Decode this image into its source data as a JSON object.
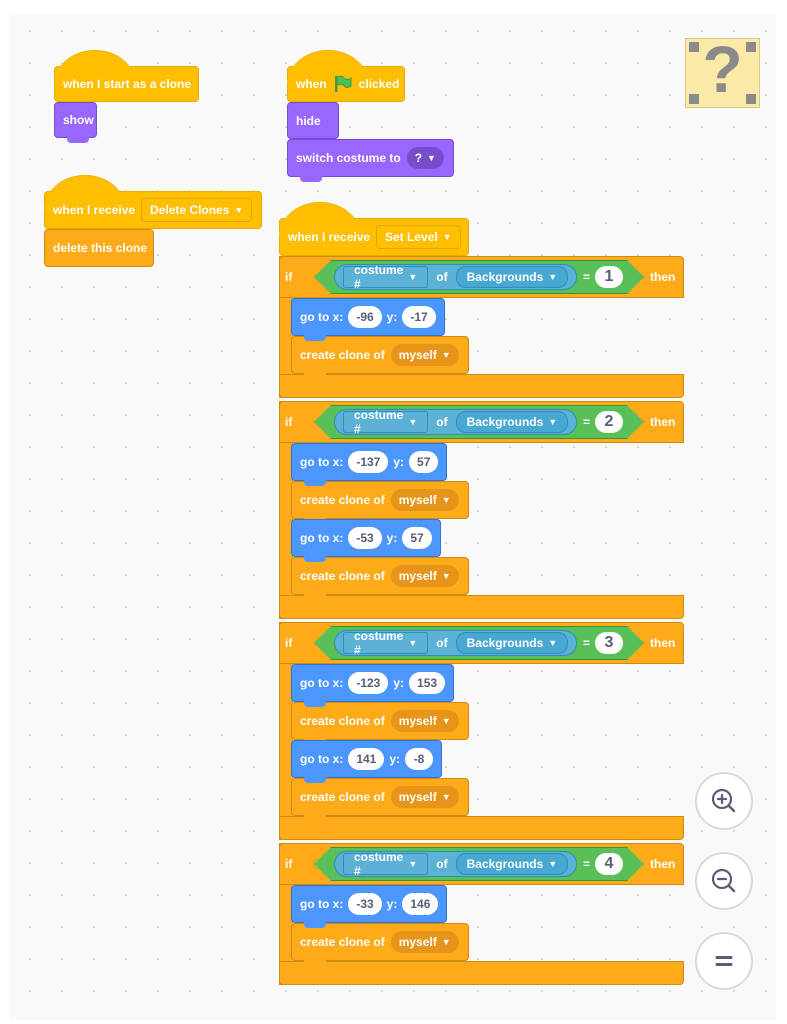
{
  "canvas": {
    "background": "#f9f9f9"
  },
  "sprite_thumbnail": {
    "icon": "question-mark-block-icon",
    "glyph": "?"
  },
  "scripts": {
    "clone_start": {
      "hat_label": "when I start as a clone",
      "show_label": "show"
    },
    "delete_clones": {
      "hat_label": "when I receive",
      "message": "Delete Clones",
      "delete_label": "delete this clone"
    },
    "flag": {
      "when_label": "when",
      "clicked_label": "clicked",
      "hide_label": "hide",
      "switch_label": "switch costume to",
      "costume_value": "?"
    },
    "set_level": {
      "hat_label": "when I receive",
      "message": "Set Level",
      "if_label": "if",
      "then_label": "then",
      "of_label": "of",
      "property": "costume #",
      "target": "Backgrounds",
      "equals": "=",
      "goto_label": "go to x:",
      "y_label": "y:",
      "clone_label": "create clone of",
      "clone_target": "myself",
      "branches": [
        {
          "value": "1",
          "moves": [
            {
              "x": "-96",
              "y": "-17"
            }
          ]
        },
        {
          "value": "2",
          "moves": [
            {
              "x": "-137",
              "y": "57"
            },
            {
              "x": "-53",
              "y": "57"
            }
          ]
        },
        {
          "value": "3",
          "moves": [
            {
              "x": "-123",
              "y": "153"
            },
            {
              "x": "141",
              "y": "-8"
            }
          ]
        },
        {
          "value": "4",
          "moves": [
            {
              "x": "-33",
              "y": "146"
            }
          ]
        }
      ]
    }
  },
  "zoom_controls": [
    {
      "name": "zoom-in",
      "icon": "zoom-in-icon"
    },
    {
      "name": "zoom-out",
      "icon": "zoom-out-icon"
    },
    {
      "name": "reset-zoom",
      "icon": "equals-icon"
    }
  ],
  "colors": {
    "events": "#ffbf00",
    "control": "#ffab19",
    "looks": "#9966ff",
    "motion": "#4c97ff",
    "operators": "#59c059",
    "sensing": "#5cb1d6"
  }
}
